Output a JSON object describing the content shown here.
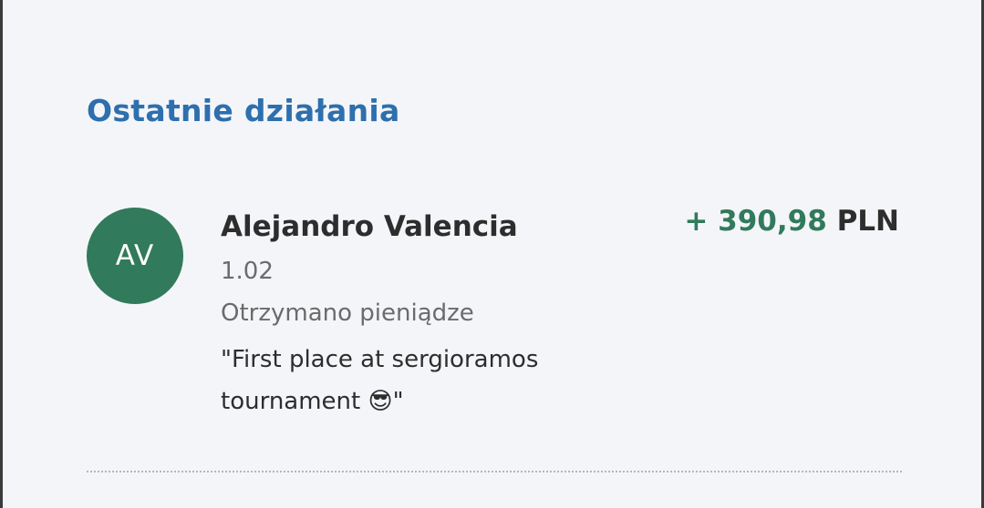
{
  "recent_activity": {
    "title": "Ostatnie działania",
    "items": [
      {
        "avatar_initials": "AV",
        "avatar_color": "#317a5b",
        "name": "Alejandro Valencia",
        "date": "1.02",
        "type": "Otrzymano pieniądze",
        "note": "\"First place at sergioramos tournament 😎\"",
        "amount": "+ 390,98",
        "currency": "PLN",
        "amount_color": "#317a5b"
      }
    ]
  },
  "theme": {
    "title_color": "#2e6fad",
    "background": "#f4f5f9"
  }
}
